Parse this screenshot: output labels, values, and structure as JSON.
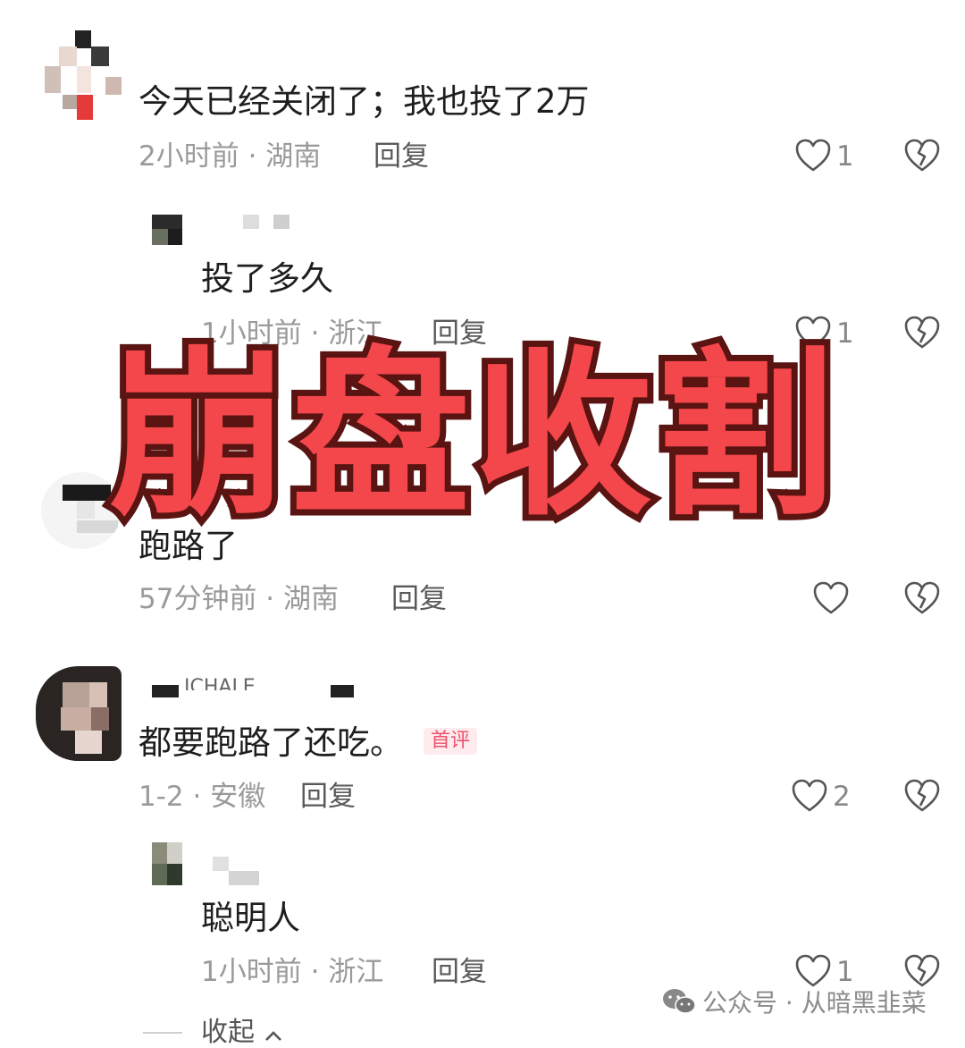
{
  "comments": [
    {
      "text": "今天已经关闭了；我也投了2万",
      "meta": "2小时前 · 湖南",
      "reply_label": "回复",
      "likes": "1",
      "replies": [
        {
          "username_partial": "",
          "text": "投了多久",
          "meta": "1小时前 · 浙江",
          "reply_label": "回复",
          "likes": "1"
        }
      ]
    },
    {
      "text": "跑路了",
      "meta": "57分钟前 · 湖南",
      "reply_label": "回复",
      "likes": ""
    },
    {
      "username_partial": "ICHALE",
      "text": "都要跑路了还吃。",
      "badge": "首评",
      "meta": "1-2 · 安徽",
      "reply_label": "回复",
      "likes": "2",
      "replies": [
        {
          "text": "聪明人",
          "meta": "1小时前 · 浙江",
          "reply_label": "回复",
          "likes": "1"
        }
      ]
    }
  ],
  "collapse_label": "收起",
  "overlay_text": "崩盘收割",
  "watermark": "公众号 · 从暗黑韭菜",
  "colors": {
    "overlay_fill": "#f4474c",
    "overlay_stroke": "#5a1412",
    "badge": "#f0506e"
  },
  "icons": [
    "heart-icon",
    "broken-heart-icon",
    "wechat-icon",
    "chevron-up-icon"
  ]
}
